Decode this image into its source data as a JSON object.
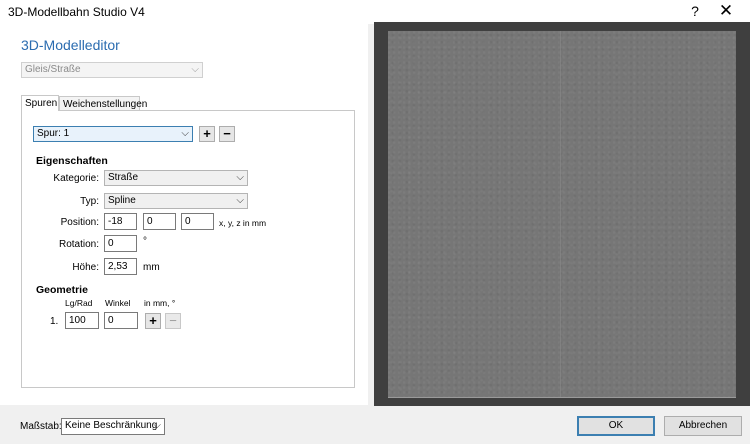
{
  "window": {
    "title": "3D-Modellbahn Studio V4",
    "help_label": "?",
    "close_label": "✕"
  },
  "editor": {
    "heading": "3D-Modelleditor",
    "type_select": "Gleis/Straße",
    "tabs": [
      "Spuren",
      "Weichenstellungen"
    ],
    "track": {
      "selected": "Spur: 1",
      "add_label": "+",
      "remove_label": "−"
    },
    "properties": {
      "heading": "Eigenschaften",
      "category_label": "Kategorie:",
      "category_value": "Straße",
      "type_label": "Typ:",
      "type_value": "Spline",
      "position_label": "Position:",
      "position_x": "-18",
      "position_y": "0",
      "position_z": "0",
      "position_unit": "x, y, z in mm",
      "rotation_label": "Rotation:",
      "rotation_value": "0",
      "rotation_unit": "°",
      "height_label": "Höhe:",
      "height_value": "2,53",
      "height_unit": "mm"
    },
    "geometry": {
      "heading": "Geometrie",
      "col_length": "Lg/Rad",
      "col_angle": "Winkel",
      "col_unit": "in mm, °",
      "rows": [
        {
          "index": "1.",
          "length": "100",
          "angle": "0"
        }
      ],
      "add_label": "+",
      "remove_label": "−"
    }
  },
  "footer": {
    "scale_label": "Maßstab:",
    "scale_value": "Keine Beschränkung",
    "ok_label": "OK",
    "cancel_label": "Abbrechen"
  },
  "icons": [
    "help-icon",
    "close-icon",
    "chevron-down-icon",
    "plus-icon",
    "minus-icon"
  ],
  "colors": {
    "heading": "#2b6cb0",
    "preview_frame": "#3f3f3f",
    "preview_surface": "#767676",
    "default_button_border": "#3c7fb1"
  }
}
